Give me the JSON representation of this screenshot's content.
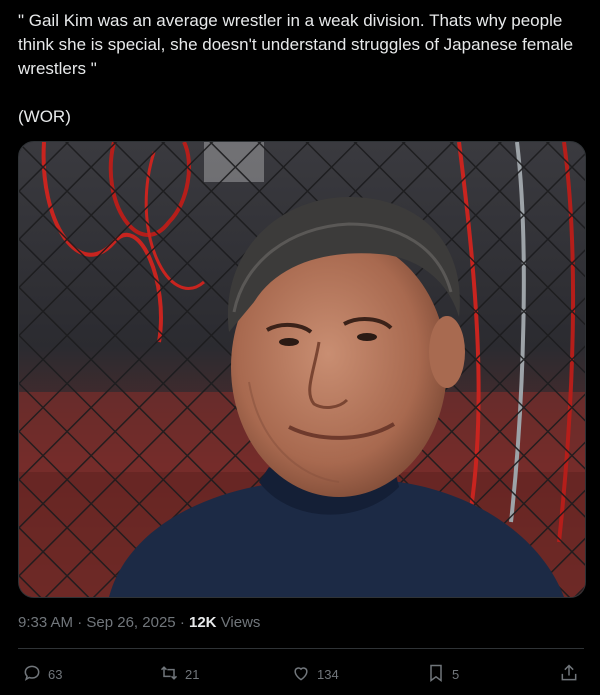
{
  "tweet": {
    "text": "\" Gail Kim was an average wrestler in a weak division. Thats why people think she is special, she doesn't understand struggles of Japanese female wrestlers \"",
    "source": "(WOR)"
  },
  "media": {
    "type": "photo",
    "alt_description": "man in front of chain-link fence"
  },
  "meta": {
    "time": "9:33 AM",
    "separator_1": "·",
    "date": "Sep 26, 2025",
    "separator_2": "·",
    "views_count": "12K",
    "views_label": "Views"
  },
  "actions": {
    "replies": "63",
    "reposts": "21",
    "likes": "134",
    "bookmarks": "5"
  },
  "icons": {
    "reply": "reply-icon",
    "repost": "repost-icon",
    "like": "heart-icon",
    "bookmark": "bookmark-icon",
    "share": "share-icon"
  },
  "colors": {
    "background": "#000000",
    "text": "#e7e9ea",
    "muted": "#71767b",
    "border": "#2f3336"
  }
}
